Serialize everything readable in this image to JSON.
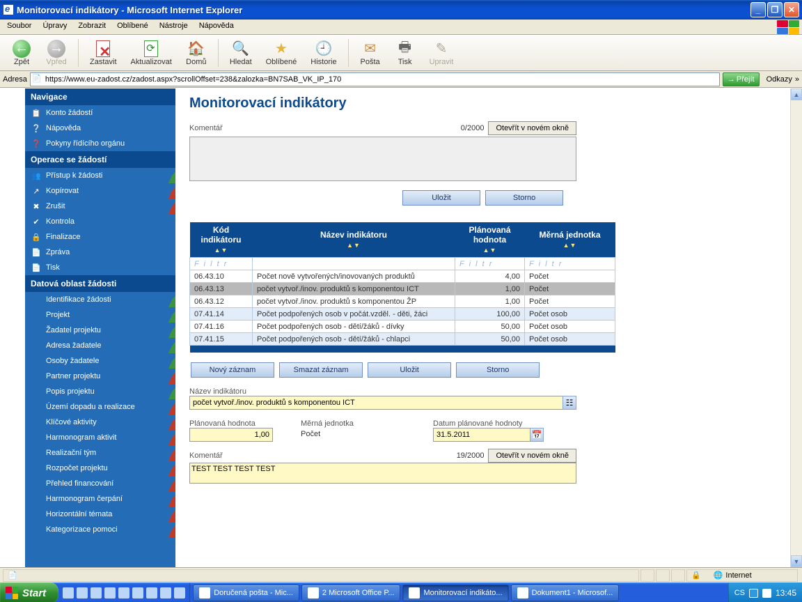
{
  "window": {
    "title": "Monitorovací indikátory - Microsoft Internet Explorer"
  },
  "menubar": [
    "Soubor",
    "Úpravy",
    "Zobrazit",
    "Oblíbené",
    "Nástroje",
    "Nápověda"
  ],
  "toolbar": {
    "back": "Zpět",
    "forward": "Vpřed",
    "stop": "Zastavit",
    "refresh": "Aktualizovat",
    "home": "Domů",
    "search": "Hledat",
    "favorites": "Oblíbené",
    "history": "Historie",
    "mail": "Pošta",
    "print": "Tisk",
    "edit": "Upravit"
  },
  "addressbar": {
    "label": "Adresa",
    "url": "https://www.eu-zadost.cz/zadost.aspx?scrollOffset=238&zalozka=BN7SAB_VK_IP_170",
    "go": "Přejít",
    "links": "Odkazy"
  },
  "sidebar": {
    "nav_header": "Navigace",
    "nav": [
      {
        "label": "Konto žádostí",
        "icon": "📋",
        "edge": ""
      },
      {
        "label": "Nápověda",
        "icon": "❔",
        "edge": ""
      },
      {
        "label": "Pokyny řídícího orgánu",
        "icon": "❓",
        "edge": ""
      }
    ],
    "ops_header": "Operace se žádostí",
    "ops": [
      {
        "label": "Přístup k žádosti",
        "icon": "👥",
        "edge": "g"
      },
      {
        "label": "Kopírovat",
        "icon": "↗",
        "edge": "r"
      },
      {
        "label": "Zrušit",
        "icon": "✖",
        "edge": "r"
      },
      {
        "label": "Kontrola",
        "icon": "✔",
        "edge": ""
      },
      {
        "label": "Finalizace",
        "icon": "🔒",
        "edge": ""
      },
      {
        "label": "Zpráva",
        "icon": "📄",
        "edge": ""
      },
      {
        "label": "Tisk",
        "icon": "📄",
        "edge": ""
      }
    ],
    "data_header": "Datová oblast žádosti",
    "data": [
      {
        "label": "Identifikace žádosti",
        "edge": "g"
      },
      {
        "label": "Projekt",
        "edge": "g"
      },
      {
        "label": "Žadatel projektu",
        "edge": "g"
      },
      {
        "label": "Adresa žadatele",
        "edge": "g"
      },
      {
        "label": "Osoby žadatele",
        "edge": "g"
      },
      {
        "label": "Partner projektu",
        "edge": "r"
      },
      {
        "label": "Popis projektu",
        "edge": "g"
      },
      {
        "label": "Území dopadu a realizace",
        "edge": "r"
      },
      {
        "label": "Klíčové aktivity",
        "edge": "r"
      },
      {
        "label": "Harmonogram aktivit",
        "edge": "r"
      },
      {
        "label": "Realizační tým",
        "edge": "r"
      },
      {
        "label": "Rozpočet projektu",
        "edge": "r"
      },
      {
        "label": "Přehled financování",
        "edge": "r"
      },
      {
        "label": "Harmonogram čerpání",
        "edge": "r"
      },
      {
        "label": "Horizontální témata",
        "edge": "r"
      },
      {
        "label": "Kategorizace pomoci",
        "edge": "r"
      }
    ]
  },
  "main": {
    "title": "Monitorovací indikátory",
    "comment_label": "Komentář",
    "comment_counter": "0/2000",
    "open_new_window": "Otevřít v novém okně",
    "save": "Uložit",
    "cancel": "Storno",
    "grid": {
      "col1": "Kód indikátoru",
      "col2": "Název indikátoru",
      "col3": "Plánovaná hodnota",
      "col4": "Měrná jednotka",
      "filter": "F i l t r",
      "rows": [
        {
          "code": "06.43.10",
          "name": "Počet nově vytvořených/inovovaných produktů",
          "val": "4,00",
          "unit": "Počet",
          "cls": ""
        },
        {
          "code": "06.43.13",
          "name": "počet vytvoř./inov. produktů s komponentou ICT",
          "val": "1,00",
          "unit": "Počet",
          "cls": "sel"
        },
        {
          "code": "06.43.12",
          "name": "počet vytvoř./inov. produktů s komponentou ŽP",
          "val": "1,00",
          "unit": "Počet",
          "cls": ""
        },
        {
          "code": "07.41.14",
          "name": "Počet podpořených osob v počát.vzděl. - děti, žáci",
          "val": "100,00",
          "unit": "Počet osob",
          "cls": "alt"
        },
        {
          "code": "07.41.16",
          "name": "Počet podpořených osob - dětí/žáků - dívky",
          "val": "50,00",
          "unit": "Počet osob",
          "cls": ""
        },
        {
          "code": "07.41.15",
          "name": "Počet podpořených osob - dětí/žáků - chlapci",
          "val": "50,00",
          "unit": "Počet osob",
          "cls": "alt"
        }
      ]
    },
    "new_record": "Nový záznam",
    "delete_record": "Smazat záznam",
    "save2": "Uložit",
    "cancel2": "Storno",
    "form": {
      "name_label": "Název indikátoru",
      "name_value": "počet vytvoř./inov. produktů s komponentou ICT",
      "planned_label": "Plánovaná hodnota",
      "planned_value": "1,00",
      "unit_label": "Měrná jednotka",
      "unit_value": "Počet",
      "date_label": "Datum plánované hodnoty",
      "date_value": "31.5.2011",
      "comment2_label": "Komentář",
      "comment2_counter": "19/2000",
      "comment2_value": "TEST TEST TEST TEST"
    }
  },
  "statusbar": {
    "zone": "Internet"
  },
  "taskbar": {
    "start": "Start",
    "tasks": [
      {
        "label": "Doručená pošta - Mic...",
        "cls": ""
      },
      {
        "label": "2 Microsoft Office P...",
        "cls": ""
      },
      {
        "label": "Monitorovací indikáto...",
        "cls": "act"
      },
      {
        "label": "Dokument1 - Microsof...",
        "cls": ""
      }
    ],
    "lang": "CS",
    "clock": "13:45"
  }
}
